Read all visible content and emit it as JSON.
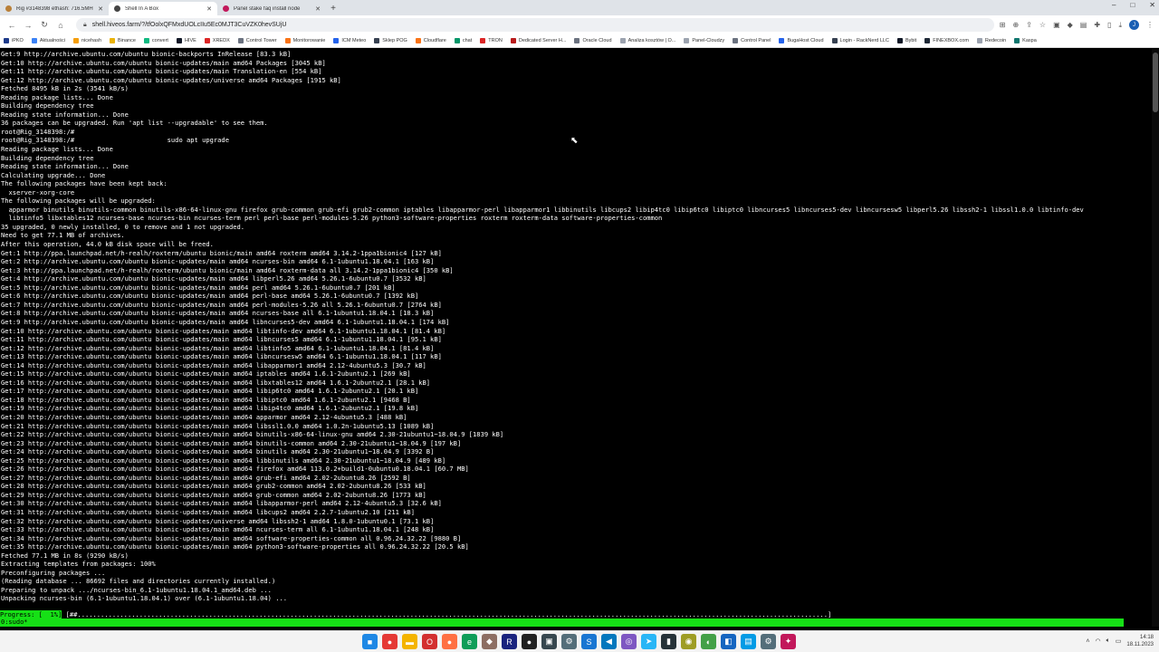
{
  "browser": {
    "tabs": [
      {
        "title": "Rig #3148398 ethash: 716.5MH",
        "color": "#b9803a",
        "active": false
      },
      {
        "title": "Shell In A Box",
        "color": "#444444",
        "active": true
      },
      {
        "title": "Panel stake faq install node",
        "color": "#c2185b",
        "active": false
      }
    ],
    "new_tab": "+",
    "window_controls": {
      "minimize": "–",
      "maximize": "□",
      "close": "✕"
    },
    "url": "shell.hiveos.farm/?/tfOolxQFMxdUOLcIIu5Ec0MJT3CuVZK0hevSUjU",
    "bookmarks": [
      {
        "label": "iPKO",
        "color": "#1e3a8a"
      },
      {
        "label": "Aktualności",
        "color": "#3b82f6"
      },
      {
        "label": "nicehash",
        "color": "#f59e0b"
      },
      {
        "label": "Binance",
        "color": "#eab308"
      },
      {
        "label": "convert",
        "color": "#10b981"
      },
      {
        "label": "HIVE",
        "color": "#111827"
      },
      {
        "label": "XREDX",
        "color": "#dc2626"
      },
      {
        "label": "Control Tower",
        "color": "#6b7280"
      },
      {
        "label": "Monitorowanie",
        "color": "#f97316"
      },
      {
        "label": "ICM Meteo",
        "color": "#2563eb"
      },
      {
        "label": "Sklep POG",
        "color": "#374151"
      },
      {
        "label": "Cloudflare",
        "color": "#f97316"
      },
      {
        "label": "chat",
        "color": "#059669"
      },
      {
        "label": "TRON",
        "color": "#dc2626"
      },
      {
        "label": "Dedicated Server H...",
        "color": "#b91c1c"
      },
      {
        "label": "Oracle Cloud",
        "color": "#6b7280"
      },
      {
        "label": "Analiza kosztów | O...",
        "color": "#9ca3af"
      },
      {
        "label": "Panel-Cloudzy",
        "color": "#9ca3af"
      },
      {
        "label": "Control Panel",
        "color": "#6b7280"
      },
      {
        "label": "BugaHost Cloud",
        "color": "#2563eb"
      },
      {
        "label": "Login - RackNerd LLC",
        "color": "#374151"
      },
      {
        "label": "Bybit",
        "color": "#111827"
      },
      {
        "label": "FINEXBOX.com",
        "color": "#1f2937"
      },
      {
        "label": "Redecoin",
        "color": "#9ca3af"
      },
      {
        "label": "Kaspa",
        "color": "#0f766e"
      }
    ]
  },
  "terminal": {
    "lines": [
      "Get:9 http://archive.ubuntu.com/ubuntu bionic-backports InRelease [83.3 kB]",
      "Get:10 http://archive.ubuntu.com/ubuntu bionic-updates/main amd64 Packages [3045 kB]",
      "Get:11 http://archive.ubuntu.com/ubuntu bionic-updates/main Translation-en [554 kB]",
      "Get:12 http://archive.ubuntu.com/ubuntu bionic-updates/universe amd64 Packages [1915 kB]",
      "Fetched 8495 kB in 2s (3541 kB/s)",
      "Reading package lists... Done",
      "Building dependency tree",
      "Reading state information... Done",
      "36 packages can be upgraded. Run 'apt list --upgradable' to see them.",
      "root@Rig_3148398:/#",
      "root@Rig_3148398:/#                        sudo apt upgrade",
      "Reading package lists... Done",
      "Building dependency tree",
      "Reading state information... Done",
      "Calculating upgrade... Done",
      "The following packages have been kept back:",
      "  xserver-xorg-core",
      "The following packages will be upgraded:",
      "  apparmor binutils binutils-common binutils-x86-64-linux-gnu firefox grub-common grub-efi grub2-common iptables libapparmor-perl libapparmor1 libbinutils libcups2 libip4tc0 libip6tc0 libiptc0 libncurses5 libncurses5-dev libncursesw5 libperl5.26 libssh2-1 libssl1.0.0 libtinfo-dev",
      "  libtinfo5 libxtables12 ncurses-base ncurses-bin ncurses-term perl perl-base perl-modules-5.26 python3-software-properties roxterm roxterm-data software-properties-common",
      "35 upgraded, 0 newly installed, 0 to remove and 1 not upgraded.",
      "Need to get 77.1 MB of archives.",
      "After this operation, 44.0 kB disk space will be freed.",
      "Get:1 http://ppa.launchpad.net/h-realh/roxterm/ubuntu bionic/main amd64 roxterm amd64 3.14.2-1ppa1bionic4 [127 kB]",
      "Get:2 http://archive.ubuntu.com/ubuntu bionic-updates/main amd64 ncurses-bin amd64 6.1-1ubuntu1.18.04.1 [163 kB]",
      "Get:3 http://ppa.launchpad.net/h-realh/roxterm/ubuntu bionic/main amd64 roxterm-data all 3.14.2-1ppa1bionic4 [350 kB]",
      "Get:4 http://archive.ubuntu.com/ubuntu bionic-updates/main amd64 libperl5.26 amd64 5.26.1-6ubuntu0.7 [3532 kB]",
      "Get:5 http://archive.ubuntu.com/ubuntu bionic-updates/main amd64 perl amd64 5.26.1-6ubuntu0.7 [201 kB]",
      "Get:6 http://archive.ubuntu.com/ubuntu bionic-updates/main amd64 perl-base amd64 5.26.1-6ubuntu0.7 [1392 kB]",
      "Get:7 http://archive.ubuntu.com/ubuntu bionic-updates/main amd64 perl-modules-5.26 all 5.26.1-6ubuntu0.7 [2764 kB]",
      "Get:8 http://archive.ubuntu.com/ubuntu bionic-updates/main amd64 ncurses-base all 6.1-1ubuntu1.18.04.1 [18.3 kB]",
      "Get:9 http://archive.ubuntu.com/ubuntu bionic-updates/main amd64 libncurses5-dev amd64 6.1-1ubuntu1.18.04.1 [174 kB]",
      "Get:10 http://archive.ubuntu.com/ubuntu bionic-updates/main amd64 libtinfo-dev amd64 6.1-1ubuntu1.18.04.1 [81.4 kB]",
      "Get:11 http://archive.ubuntu.com/ubuntu bionic-updates/main amd64 libncurses5 amd64 6.1-1ubuntu1.18.04.1 [95.1 kB]",
      "Get:12 http://archive.ubuntu.com/ubuntu bionic-updates/main amd64 libtinfo5 amd64 6.1-1ubuntu1.18.04.1 [81.4 kB]",
      "Get:13 http://archive.ubuntu.com/ubuntu bionic-updates/main amd64 libncursesw5 amd64 6.1-1ubuntu1.18.04.1 [117 kB]",
      "Get:14 http://archive.ubuntu.com/ubuntu bionic-updates/main amd64 libapparmor1 amd64 2.12-4ubuntu5.3 [30.7 kB]",
      "Get:15 http://archive.ubuntu.com/ubuntu bionic-updates/main amd64 iptables amd64 1.6.1-2ubuntu2.1 [269 kB]",
      "Get:16 http://archive.ubuntu.com/ubuntu bionic-updates/main amd64 libxtables12 amd64 1.6.1-2ubuntu2.1 [28.1 kB]",
      "Get:17 http://archive.ubuntu.com/ubuntu bionic-updates/main amd64 libip6tc0 amd64 1.6.1-2ubuntu2.1 [20.1 kB]",
      "Get:18 http://archive.ubuntu.com/ubuntu bionic-updates/main amd64 libiptc0 amd64 1.6.1-2ubuntu2.1 [9468 B]",
      "Get:19 http://archive.ubuntu.com/ubuntu bionic-updates/main amd64 libip4tc0 amd64 1.6.1-2ubuntu2.1 [19.8 kB]",
      "Get:20 http://archive.ubuntu.com/ubuntu bionic-updates/main amd64 apparmor amd64 2.12-4ubuntu5.3 [488 kB]",
      "Get:21 http://archive.ubuntu.com/ubuntu bionic-updates/main amd64 libssl1.0.0 amd64 1.0.2n-1ubuntu5.13 [1089 kB]",
      "Get:22 http://archive.ubuntu.com/ubuntu bionic-updates/main amd64 binutils-x86-64-linux-gnu amd64 2.30-21ubuntu1~18.04.9 [1839 kB]",
      "Get:23 http://archive.ubuntu.com/ubuntu bionic-updates/main amd64 binutils-common amd64 2.30-21ubuntu1~18.04.9 [197 kB]",
      "Get:24 http://archive.ubuntu.com/ubuntu bionic-updates/main amd64 binutils amd64 2.30-21ubuntu1~18.04.9 [3392 B]",
      "Get:25 http://archive.ubuntu.com/ubuntu bionic-updates/main amd64 libbinutils amd64 2.30-21ubuntu1~18.04.9 [489 kB]",
      "Get:26 http://archive.ubuntu.com/ubuntu bionic-updates/main amd64 firefox amd64 113.0.2+build1-0ubuntu0.18.04.1 [60.7 MB]",
      "Get:27 http://archive.ubuntu.com/ubuntu bionic-updates/main amd64 grub-efi amd64 2.02-2ubuntu8.26 [2592 B]",
      "Get:28 http://archive.ubuntu.com/ubuntu bionic-updates/main amd64 grub2-common amd64 2.02-2ubuntu8.26 [533 kB]",
      "Get:29 http://archive.ubuntu.com/ubuntu bionic-updates/main amd64 grub-common amd64 2.02-2ubuntu8.26 [1773 kB]",
      "Get:30 http://archive.ubuntu.com/ubuntu bionic-updates/main amd64 libapparmor-perl amd64 2.12-4ubuntu5.3 [32.6 kB]",
      "Get:31 http://archive.ubuntu.com/ubuntu bionic-updates/main amd64 libcups2 amd64 2.2.7-1ubuntu2.10 [211 kB]",
      "Get:32 http://archive.ubuntu.com/ubuntu bionic-updates/universe amd64 libssh2-1 amd64 1.8.0-1ubuntu0.1 [73.1 kB]",
      "Get:33 http://archive.ubuntu.com/ubuntu bionic-updates/main amd64 ncurses-term all 6.1-1ubuntu1.18.04.1 [248 kB]",
      "Get:34 http://archive.ubuntu.com/ubuntu bionic-updates/main amd64 software-properties-common all 0.96.24.32.22 [9880 B]",
      "Get:35 http://archive.ubuntu.com/ubuntu bionic-updates/main amd64 python3-software-properties all 0.96.24.32.22 [20.5 kB]",
      "Fetched 77.1 MB in 8s (9290 kB/s)",
      "Extracting templates from packages: 100%",
      "Preconfiguring packages ...",
      "(Reading database ... 86692 files and directories currently installed.)",
      "Preparing to unpack .../ncurses-bin_6.1-1ubuntu1.18.04.1_amd64.deb ...",
      "Unpacking ncurses-bin (6.1-1ubuntu1.18.04.1) over (6.1-1ubuntu1.18.04) ..."
    ],
    "progress_label": "Progress: [  1%]",
    "progress_bar": "[##..................................................................................................................................................................................................]",
    "status_line": "0:sudo*"
  },
  "taskbar": {
    "apps": [
      {
        "name": "windows-start-icon",
        "color": "#1e88e5",
        "glyph": "■"
      },
      {
        "name": "chrome-icon",
        "color": "#e53935",
        "glyph": "●"
      },
      {
        "name": "file-explorer-icon",
        "color": "#f4b400",
        "glyph": "▬"
      },
      {
        "name": "opera-icon",
        "color": "#d32f2f",
        "glyph": "O"
      },
      {
        "name": "firefox-icon",
        "color": "#ff7043",
        "glyph": "●"
      },
      {
        "name": "edge-icon",
        "color": "#0f9d58",
        "glyph": "e"
      },
      {
        "name": "app-icon-1",
        "color": "#8d6e63",
        "glyph": "◆"
      },
      {
        "name": "app-icon-2",
        "color": "#1a237e",
        "glyph": "R"
      },
      {
        "name": "app-icon-3",
        "color": "#212121",
        "glyph": "●"
      },
      {
        "name": "app-icon-4",
        "color": "#37474f",
        "glyph": "▣"
      },
      {
        "name": "app-icon-5",
        "color": "#546e7a",
        "glyph": "⚙"
      },
      {
        "name": "app-icon-6",
        "color": "#1976d2",
        "glyph": "S"
      },
      {
        "name": "vscode-icon",
        "color": "#0277bd",
        "glyph": "◀"
      },
      {
        "name": "app-icon-7",
        "color": "#7e57c2",
        "glyph": "◎"
      },
      {
        "name": "telegram-icon",
        "color": "#29b6f6",
        "glyph": "➤"
      },
      {
        "name": "terminal-icon",
        "color": "#263238",
        "glyph": "▮"
      },
      {
        "name": "app-icon-8",
        "color": "#9e9d24",
        "glyph": "◉"
      },
      {
        "name": "app-icon-9",
        "color": "#43a047",
        "glyph": "◐"
      },
      {
        "name": "app-icon-10",
        "color": "#1565c0",
        "glyph": "◧"
      },
      {
        "name": "app-icon-11",
        "color": "#039be5",
        "glyph": "▤"
      },
      {
        "name": "app-icon-12",
        "color": "#546e7a",
        "glyph": "⚙"
      },
      {
        "name": "app-icon-13",
        "color": "#c2185b",
        "glyph": "✦"
      }
    ],
    "time": "14:18",
    "date": "18.11.2023"
  }
}
